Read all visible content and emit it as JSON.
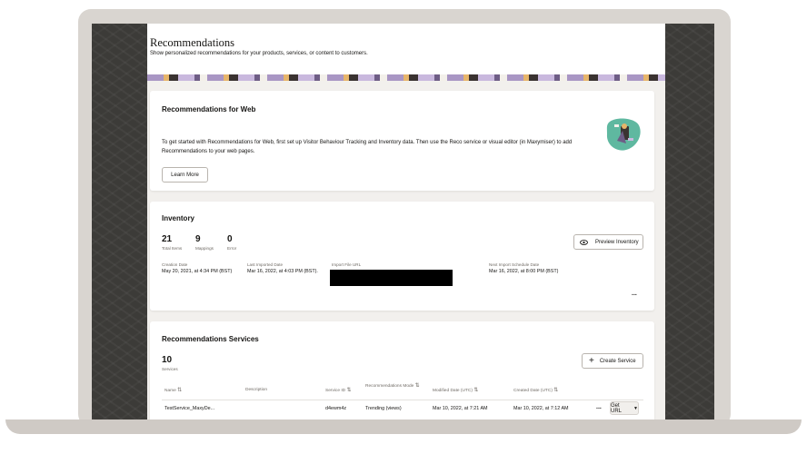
{
  "header": {
    "title": "Recommendations",
    "subtitle": "Show personalized recommendations for your products, services, or content to customers."
  },
  "web_card": {
    "title": "Recommendations for Web",
    "description": "To get started with Recommendations for Web, first set up Visitor Behaviour Tracking and Inventory data. Then use the Reco service or visual editor (in Maxymiser) to add Recommendations to your web pages.",
    "learn_more_label": "Learn More"
  },
  "inventory": {
    "title": "Inventory",
    "stats": [
      {
        "value": "21",
        "label": "Total Items"
      },
      {
        "value": "9",
        "label": "Mappings"
      },
      {
        "value": "0",
        "label": "Error"
      }
    ],
    "preview_label": "Preview Inventory",
    "fields": [
      {
        "label": "Creation Date",
        "value": "May 20, 2021, at 4:34 PM (BST)"
      },
      {
        "label": "Last Imported Date",
        "value": "Mar 16, 2022, at 4:03 PM (BST)."
      },
      {
        "label": "Import File URL",
        "value": ""
      },
      {
        "label": "Next Import Schedule Date",
        "value": "Mar 16, 2022, at 8:00 PM (BST)"
      }
    ],
    "more_label": "..."
  },
  "services": {
    "title": "Recommendations Services",
    "count": "10",
    "count_label": "Services",
    "create_label": "Create Service",
    "columns": [
      "Name",
      "Description",
      "Service ID",
      "Recommendations Mode",
      "Modified Date (UTC)",
      "Created Date (UTC)"
    ],
    "rows": [
      {
        "name": "TestService_MaxyDe...",
        "description": "",
        "service_id": "d4ewm4z",
        "mode": "Trending (views)",
        "modified": "Mar 10, 2022, at 7:21 AM",
        "created": "Mar 10, 2022, at 7:12 AM",
        "more": "...",
        "action": "Get URL"
      }
    ]
  },
  "colors": {
    "app_bg": "#f2f0ed",
    "card_bg": "#ffffff",
    "text": "#161513",
    "illustration_bg": "#5fb8a0"
  }
}
